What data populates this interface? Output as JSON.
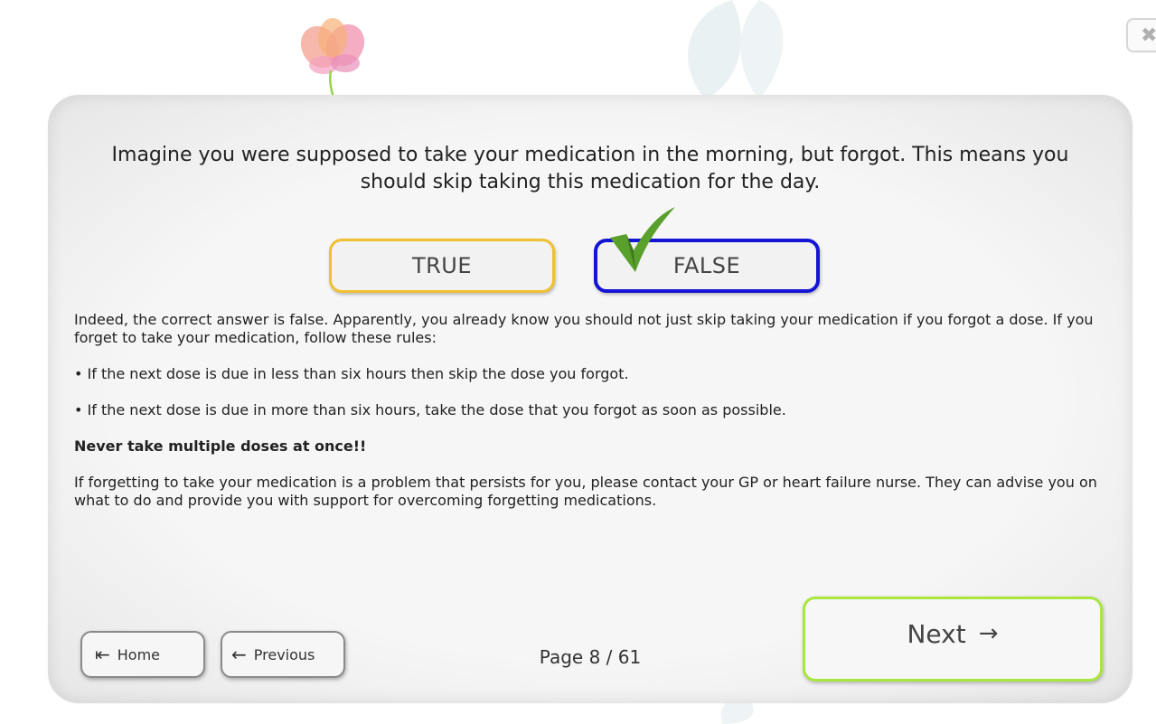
{
  "header": {
    "close_label": "✖"
  },
  "question": {
    "text": "Imagine you were supposed to take your medication in the morning, but forgot. This means you should skip taking this medication for the day."
  },
  "answers": {
    "true_label": "TRUE",
    "false_label": "FALSE",
    "selected": "FALSE"
  },
  "feedback": {
    "intro": "Indeed, the correct answer is false. Apparently, you already know you should not just skip taking your medication if you forgot a dose. If you forget to take your medication, follow these rules:",
    "bullet_1": "• If the next dose is due in less than six hours then skip the dose you forgot.",
    "bullet_2": "• If the next dose is due in more than six hours, take the dose that you forgot as soon as possible.",
    "warning": "Never take multiple doses at once!!",
    "closing": "If forgetting to take your medication is a problem that persists for you, please contact your GP or heart failure nurse. They can advise you on what to do and provide you with support for overcoming forgetting medications."
  },
  "navigation": {
    "home_label": "Home",
    "home_icon": "⇤",
    "previous_label": "Previous",
    "previous_icon": "←",
    "page_indicator": "Page 8 / 61",
    "next_label": "Next",
    "next_icon": "→"
  },
  "colors": {
    "true_border": "#f0c030",
    "false_border": "#1414d4",
    "next_border": "#a8e640",
    "check_green": "#5aa02c"
  }
}
